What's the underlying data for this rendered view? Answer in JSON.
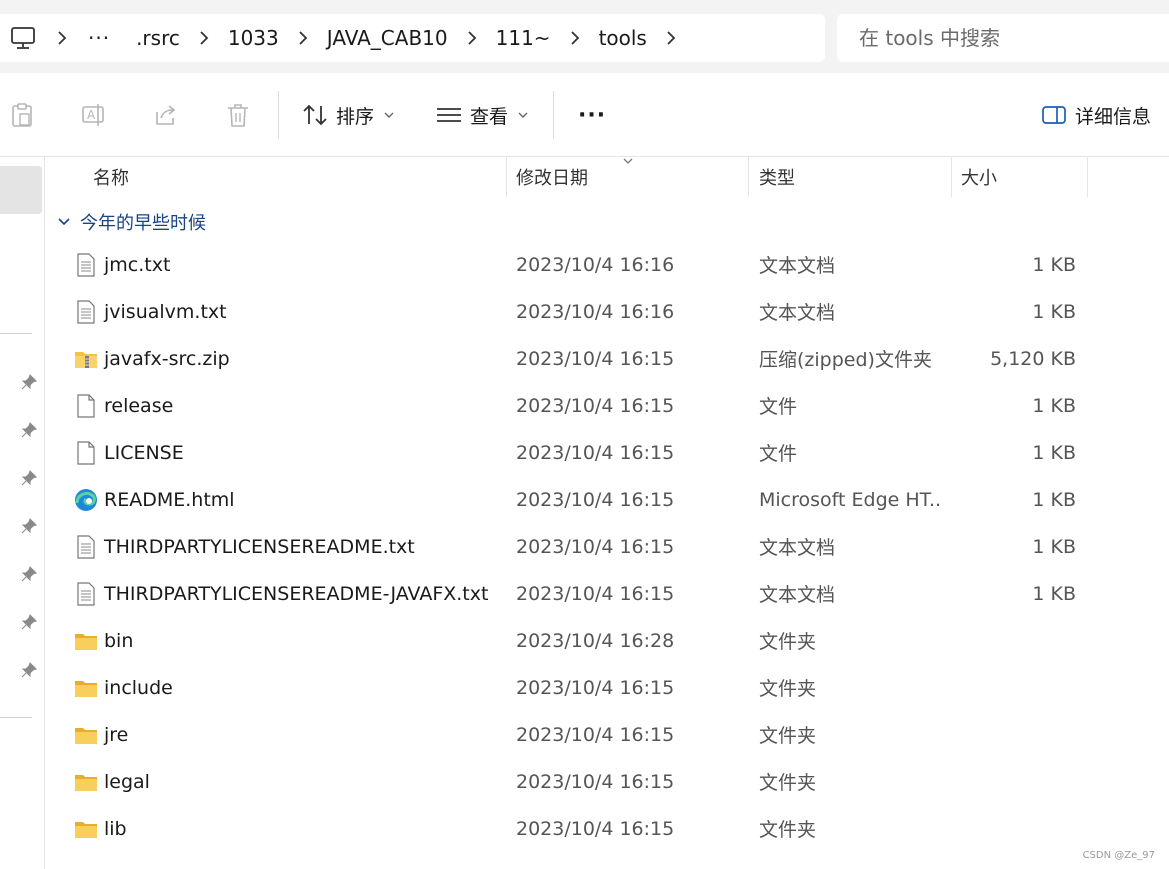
{
  "address": {
    "crumbs": [
      "···",
      ".rsrc",
      "1033",
      "JAVA_CAB10",
      "111~",
      "tools"
    ]
  },
  "search": {
    "placeholder": "在 tools 中搜索"
  },
  "toolbar": {
    "sort_label": "排序",
    "view_label": "查看",
    "more_label": "···",
    "details_label": "详细信息"
  },
  "columns": {
    "name": "名称",
    "date": "修改日期",
    "type": "类型",
    "size": "大小"
  },
  "group": {
    "label": "今年的早些时候"
  },
  "files": [
    {
      "name": "jmc.txt",
      "icon": "text-file-icon",
      "date": "2023/10/4 16:16",
      "type": "文本文档",
      "size": "1 KB"
    },
    {
      "name": "jvisualvm.txt",
      "icon": "text-file-icon",
      "date": "2023/10/4 16:16",
      "type": "文本文档",
      "size": "1 KB"
    },
    {
      "name": "javafx-src.zip",
      "icon": "zip-folder-icon",
      "date": "2023/10/4 16:15",
      "type": "压缩(zipped)文件夹",
      "size": "5,120 KB"
    },
    {
      "name": "release",
      "icon": "blank-file-icon",
      "date": "2023/10/4 16:15",
      "type": "文件",
      "size": "1 KB"
    },
    {
      "name": "LICENSE",
      "icon": "blank-file-icon",
      "date": "2023/10/4 16:15",
      "type": "文件",
      "size": "1 KB"
    },
    {
      "name": "README.html",
      "icon": "edge-icon",
      "date": "2023/10/4 16:15",
      "type": "Microsoft Edge HT...",
      "size": "1 KB"
    },
    {
      "name": "THIRDPARTYLICENSEREADME.txt",
      "icon": "text-file-icon",
      "date": "2023/10/4 16:15",
      "type": "文本文档",
      "size": "1 KB"
    },
    {
      "name": "THIRDPARTYLICENSEREADME-JAVAFX.txt",
      "icon": "text-file-icon",
      "date": "2023/10/4 16:15",
      "type": "文本文档",
      "size": "1 KB"
    },
    {
      "name": "bin",
      "icon": "folder-icon",
      "date": "2023/10/4 16:28",
      "type": "文件夹",
      "size": ""
    },
    {
      "name": "include",
      "icon": "folder-icon",
      "date": "2023/10/4 16:15",
      "type": "文件夹",
      "size": ""
    },
    {
      "name": "jre",
      "icon": "folder-icon",
      "date": "2023/10/4 16:15",
      "type": "文件夹",
      "size": ""
    },
    {
      "name": "legal",
      "icon": "folder-icon",
      "date": "2023/10/4 16:15",
      "type": "文件夹",
      "size": ""
    },
    {
      "name": "lib",
      "icon": "folder-icon",
      "date": "2023/10/4 16:15",
      "type": "文件夹",
      "size": ""
    }
  ],
  "watermark": "CSDN @Ze_97",
  "colors": {
    "group_header": "#1a4480",
    "folder": "#f5c242",
    "nav_selected": "#e4e4e4"
  }
}
